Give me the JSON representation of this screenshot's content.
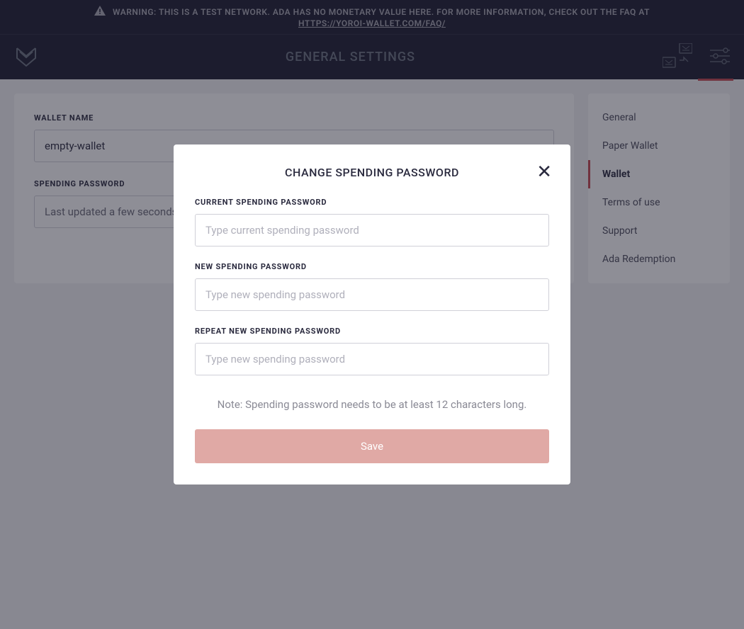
{
  "warning": {
    "text": "WARNING: THIS IS A TEST NETWORK. ADA HAS NO MONETARY VALUE HERE. FOR MORE INFORMATION, CHECK OUT THE FAQ AT",
    "link": "HTTPS://YOROI-WALLET.COM/FAQ/"
  },
  "header": {
    "title": "GENERAL SETTINGS"
  },
  "main": {
    "wallet_name_label": "WALLET NAME",
    "wallet_name_value": "empty-wallet",
    "spending_password_label": "SPENDING PASSWORD",
    "spending_password_value": "Last updated a few seconds ago"
  },
  "sidebar": {
    "items": [
      {
        "label": "General"
      },
      {
        "label": "Paper Wallet"
      },
      {
        "label": "Wallet"
      },
      {
        "label": "Terms of use"
      },
      {
        "label": "Support"
      },
      {
        "label": "Ada Redemption"
      }
    ]
  },
  "modal": {
    "title": "CHANGE SPENDING PASSWORD",
    "current_label": "CURRENT SPENDING PASSWORD",
    "current_placeholder": "Type current spending password",
    "new_label": "NEW SPENDING PASSWORD",
    "new_placeholder": "Type new spending password",
    "repeat_label": "REPEAT NEW SPENDING PASSWORD",
    "repeat_placeholder": "Type new spending password",
    "note": "Note: Spending password needs to be at least 12 characters long.",
    "save_label": "Save"
  }
}
